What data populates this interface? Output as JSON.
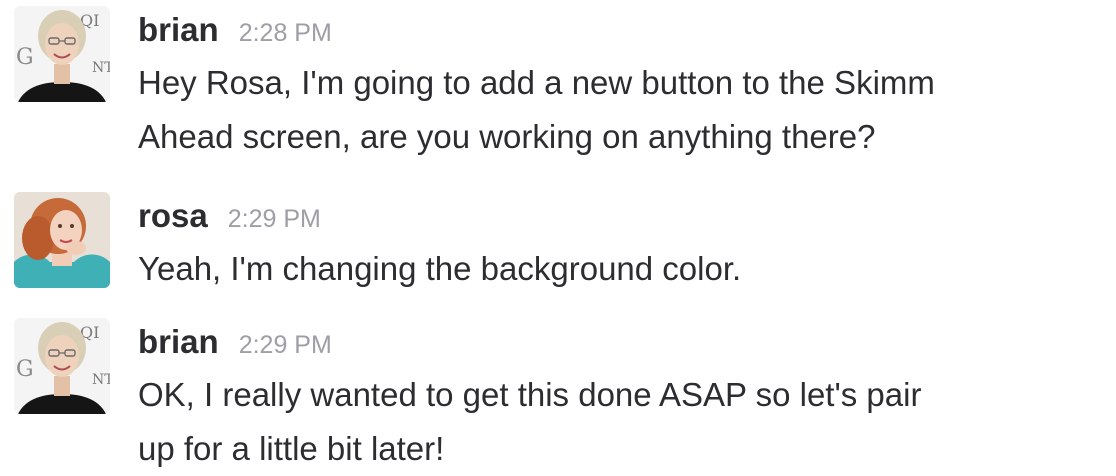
{
  "messages": [
    {
      "username": "brian",
      "time": "2:28 PM",
      "lines": [
        "Hey Rosa, I'm going to add a new button to the Skimm",
        "Ahead screen, are you working on anything there?"
      ],
      "avatar": "user-avatar-brian"
    },
    {
      "username": "rosa",
      "time": "2:29 PM",
      "lines": [
        "Yeah, I'm changing the background color."
      ],
      "avatar": "user-avatar-rosa"
    },
    {
      "username": "brian",
      "time": "2:29 PM",
      "lines": [
        "OK, I really wanted to get this done ASAP so let's pair",
        "up for a little bit later!"
      ],
      "avatar": "user-avatar-brian"
    }
  ],
  "colors": {
    "username": "#2c2d30",
    "timestamp": "#9e9ea6",
    "text": "#2c2d30",
    "background": "#ffffff"
  }
}
